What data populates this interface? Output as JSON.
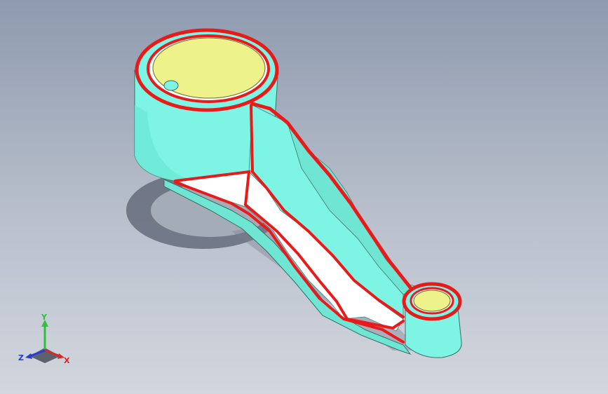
{
  "colors": {
    "background_top": "#8e9aae",
    "background_bottom": "#d2d6de",
    "body": "#7ef5e4",
    "body_shade": "#5fdcc9",
    "edge_highlight": "#e81a1a",
    "bore_inner": "#eef28a",
    "web_face": "#ffffff"
  },
  "triad": {
    "y_label": "Y",
    "z_label": "Z",
    "x_label": "X",
    "y_color": "#2fbf3a",
    "z_color": "#2a3cd6",
    "x_color": "#d42a2a"
  }
}
